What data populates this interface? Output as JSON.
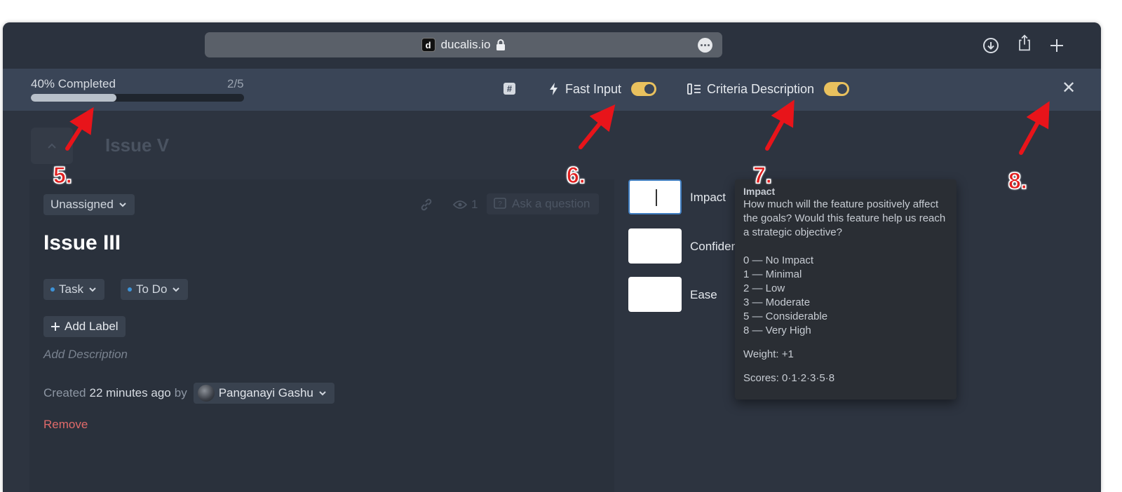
{
  "browser": {
    "favicon_letter": "d",
    "url": "ducalis.io"
  },
  "header": {
    "progress_label": "40% Completed",
    "progress_count": "2/5",
    "progress_fraction": 0.4,
    "fast_input_label": "Fast Input",
    "criteria_label": "Criteria Description",
    "toggle_color": "#e9c15e"
  },
  "background_issue": {
    "title": "Issue V"
  },
  "issue": {
    "assignee": "Unassigned",
    "views": "1",
    "ask_placeholder": "Ask a question",
    "title": "Issue III",
    "type": "Task",
    "status": "To Do",
    "add_label": "Add Label",
    "add_description": "Add Description",
    "created_prefix": "Created",
    "created_time": "22 minutes ago",
    "created_by": "by",
    "author": "Panganayi Gashu",
    "remove": "Remove"
  },
  "criteria": [
    {
      "label": "Impact"
    },
    {
      "label": "Confiden"
    },
    {
      "label": "Ease"
    }
  ],
  "tooltip": {
    "title": "Impact",
    "description": "How much will the feature positively affect the goals? Would this feature help us reach a strategic objective?",
    "scale": [
      "0 — No Impact",
      "1 — Minimal",
      "2 — Low",
      "3 — Moderate",
      "5 — Considerable",
      "8 — Very High"
    ],
    "weight": "Weight: +1",
    "scores": "Scores: 0·1·2·3·5·8"
  },
  "annotations": [
    "5.",
    "6.",
    "7.",
    "8."
  ]
}
